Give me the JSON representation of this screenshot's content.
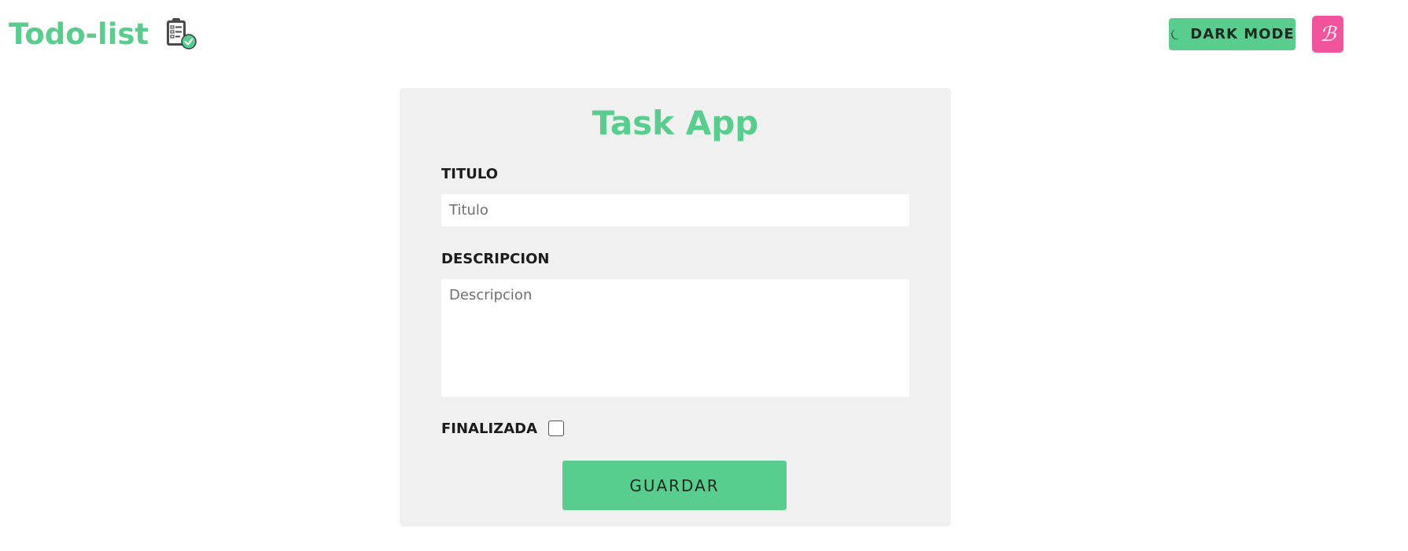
{
  "header": {
    "brand_title": "Todo-list",
    "brand_icon": "clipboard-check-icon",
    "dark_mode_label": "DARK MODE",
    "dark_mode_icon": "moon-icon",
    "bootstrap_icon": "bootstrap-icon"
  },
  "form": {
    "title": "Task App",
    "titulo": {
      "label": "TITULO",
      "placeholder": "Titulo",
      "value": ""
    },
    "descripcion": {
      "label": "DESCRIPCION",
      "placeholder": "Descripcion",
      "value": ""
    },
    "finalizada": {
      "label": "FINALIZADA",
      "checked": false
    },
    "save_label": "GUARDAR"
  },
  "colors": {
    "accent": "#58cd8e",
    "card_bg": "#f0f0f0",
    "bootstrap_pink": "#f0559b"
  }
}
